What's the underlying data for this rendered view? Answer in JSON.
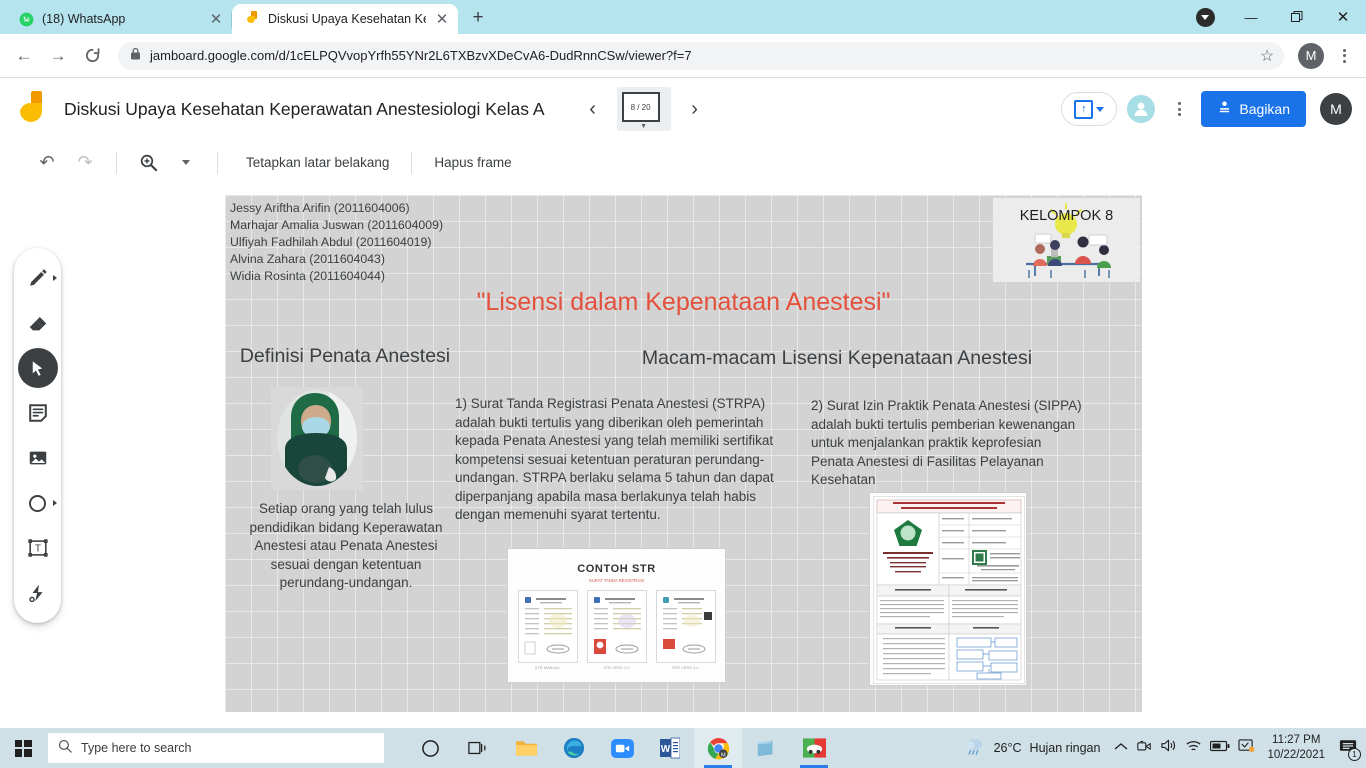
{
  "browser": {
    "tabs": [
      {
        "title": "(18) WhatsApp",
        "favicon": "whatsapp-icon",
        "active": false
      },
      {
        "title": "Diskusi Upaya Kesehatan Kepera",
        "favicon": "jamboard-icon",
        "active": true
      }
    ],
    "new_tab_label": "+",
    "close_label": "✕",
    "nav": {
      "back": "←",
      "forward": "→",
      "reload": "⟳"
    },
    "url": "jamboard.google.com/d/1cELPQVvopYrfh55YNr2L6TXBzvXDeCvA6-DudRnnCSw/viewer?f=7",
    "lock_icon": "lock-icon",
    "star_icon": "☆",
    "profile_initial": "M",
    "window_controls": {
      "minimize": "—",
      "maximize": "❐",
      "close": "✕"
    }
  },
  "jamboard": {
    "title": "Diskusi Upaya Kesehatan Keperawatan Anestesiologi Kelas A",
    "frame_counter": "8 / 20",
    "prev_label": "‹",
    "next_label": "›",
    "share_label": "Bagikan",
    "account_initial": "M",
    "toolbar": {
      "undo_label": "↶",
      "redo_label": "↷",
      "zoom_label": "zoom-in",
      "set_background_label": "Tetapkan latar belakang",
      "clear_frame_label": "Hapus frame"
    },
    "tools": [
      {
        "name": "pen-tool",
        "label": "Pen",
        "active": false,
        "expandable": true
      },
      {
        "name": "eraser-tool",
        "label": "Eraser",
        "active": false,
        "expandable": false
      },
      {
        "name": "select-tool",
        "label": "Select",
        "active": true,
        "expandable": false
      },
      {
        "name": "sticky-note-tool",
        "label": "Sticky note",
        "active": false,
        "expandable": false
      },
      {
        "name": "image-tool",
        "label": "Image",
        "active": false,
        "expandable": false
      },
      {
        "name": "shape-tool",
        "label": "Shape",
        "active": false,
        "expandable": true
      },
      {
        "name": "text-box-tool",
        "label": "Text box",
        "active": false,
        "expandable": false
      },
      {
        "name": "laser-tool",
        "label": "Laser pointer",
        "active": false,
        "expandable": false
      }
    ]
  },
  "board": {
    "members": [
      "Jessy Ariftha Arifin (2011604006)",
      "Marhajar Amalia Juswan (2011604009)",
      "Ulfiyah Fadhilah Abdul (2011604019)",
      "Alvina Zahara (2011604043)",
      "Widia Rosinta (2011604044)"
    ],
    "group_badge": "KELOMPOK 8",
    "title": "\"Lisensi dalam Kepenataan Anestesi\"",
    "title_color": "#e4503c",
    "left_column": {
      "heading": "Definisi Penata Anestesi",
      "body": "Setiap orang yang telah lulus pendidikan bidang Keperawatan Anestesi atau Penata Anestesi sesuai dengan ketentuan perundang-undangan.",
      "image_name": "penata-anestesi-photo"
    },
    "right_column": {
      "heading": "Macam-macam Lisensi Kepenataan Anestesi",
      "item1": "1) Surat Tanda Registrasi Penata Anestesi (STRPA) adalah bukti tertulis yang diberikan oleh pemerintah kepada Penata Anestesi yang telah memiliki sertifikat kompetensi sesuai ketentuan peraturan perundang-undangan. STRPA berlaku selama 5 tahun dan dapat diperpanjang apabila masa berlakunya telah habis dengan memenuhi syarat tertentu.",
      "item2": "2) Surat Izin Praktik Penata Anestesi (SIPPA) adalah bukti tertulis pemberian kewenangan untuk menjalankan praktik keprofesian Penata Anestesi di Fasilitas Pelayanan Kesehatan",
      "str_image": {
        "title": "CONTOH STR",
        "subtitle": "SURAT TANDA REGISTRASI"
      },
      "sop_image_name": "sop-sippa-document"
    }
  },
  "taskbar": {
    "start_label": "start-button",
    "search_placeholder": "Type here to search",
    "items": [
      {
        "name": "cortana-icon",
        "label": "Cortana"
      },
      {
        "name": "task-view-icon",
        "label": "Task View"
      },
      {
        "name": "file-explorer-icon",
        "label": "File Explorer"
      },
      {
        "name": "edge-icon",
        "label": "Microsoft Edge"
      },
      {
        "name": "zoom-icon",
        "label": "Zoom"
      },
      {
        "name": "word-icon",
        "label": "Microsoft Word"
      },
      {
        "name": "chrome-icon",
        "label": "Google Chrome"
      },
      {
        "name": "notepad-icon",
        "label": "Notepad"
      },
      {
        "name": "photos-icon",
        "label": "Photos"
      }
    ],
    "weather": {
      "temperature": "26°C",
      "condition": "Hujan ringan"
    },
    "tray_icons": [
      "chevron-up-icon",
      "camera-icon",
      "volume-icon",
      "wifi-icon",
      "battery-icon",
      "onedrive-icon"
    ],
    "time": "11:27 PM",
    "date": "10/22/2021",
    "notification_count": "1"
  }
}
